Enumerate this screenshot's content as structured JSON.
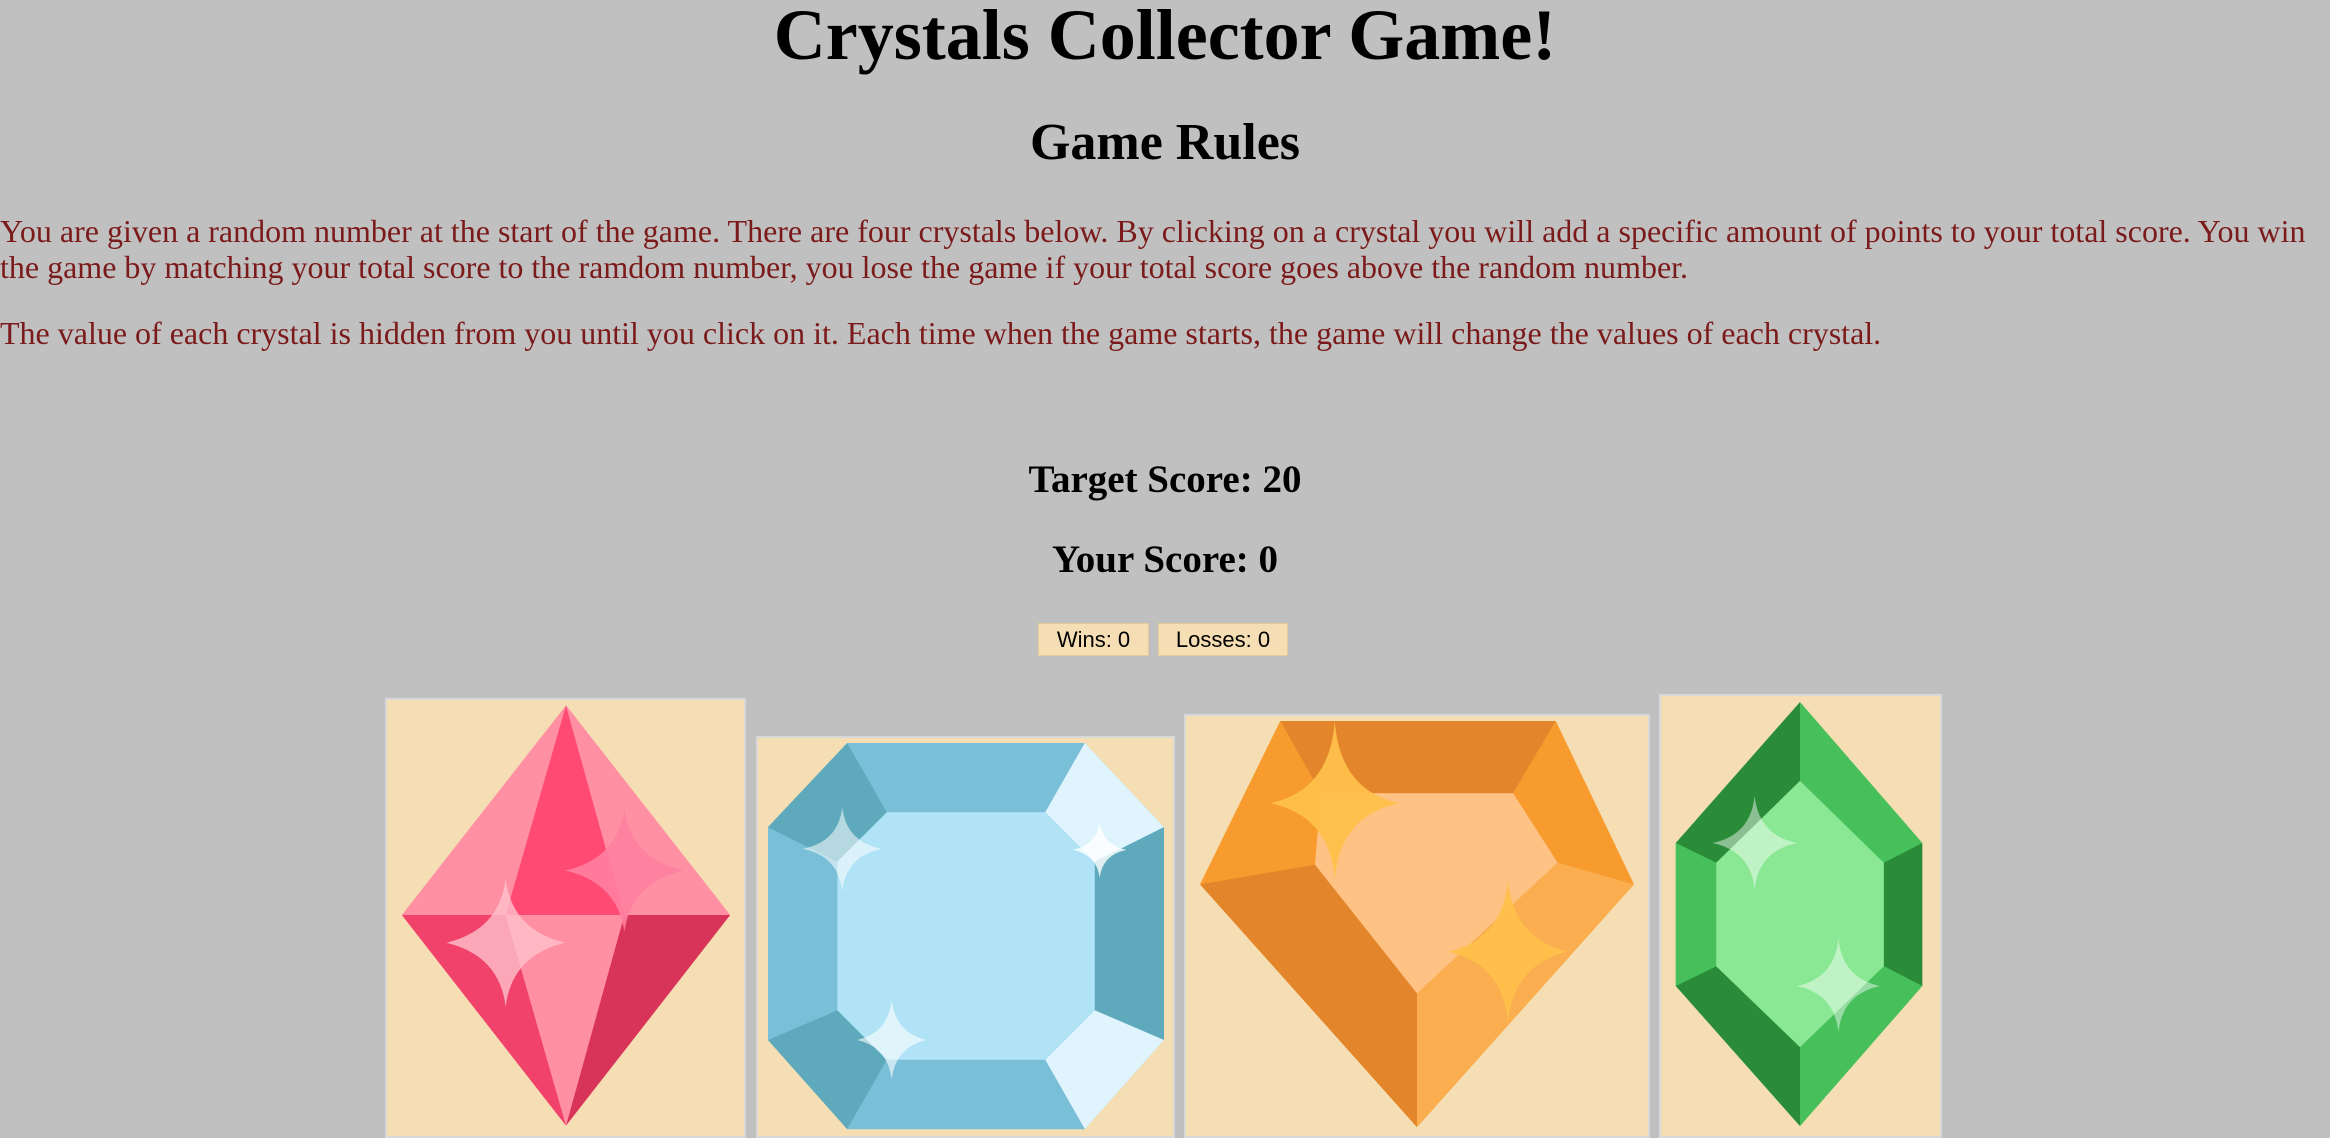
{
  "page": {
    "title": "Crystals Collector Game!",
    "rules_heading": "Game Rules",
    "rules_paragraph_1": "You are given a random number at the start of the game. There are four crystals below. By clicking on a crystal you will add a specific amount of points to your total score. You win the game by matching your total score to the ramdom number, you lose the game if your total score goes above the random number.",
    "rules_paragraph_2": "The value of each crystal is hidden from you until you click on it. Each time when the game starts, the game will change the values of each crystal."
  },
  "scoreboard": {
    "target_score": "Target Score: 20",
    "your_score": "Your Score: 0",
    "wins": "Wins: 0",
    "losses": "Losses: 0"
  },
  "crystals": [
    {
      "name": "red-crystal-icon",
      "color": "#ff4a73"
    },
    {
      "name": "blue-crystal-icon",
      "color": "#79bfd8"
    },
    {
      "name": "orange-crystal-icon",
      "color": "#f89b2e"
    },
    {
      "name": "green-crystal-icon",
      "color": "#47bf5b"
    }
  ],
  "colors": {
    "background": "#c0c0c0",
    "rules_text": "#7b1a1a",
    "panel": "#f5deb3"
  }
}
